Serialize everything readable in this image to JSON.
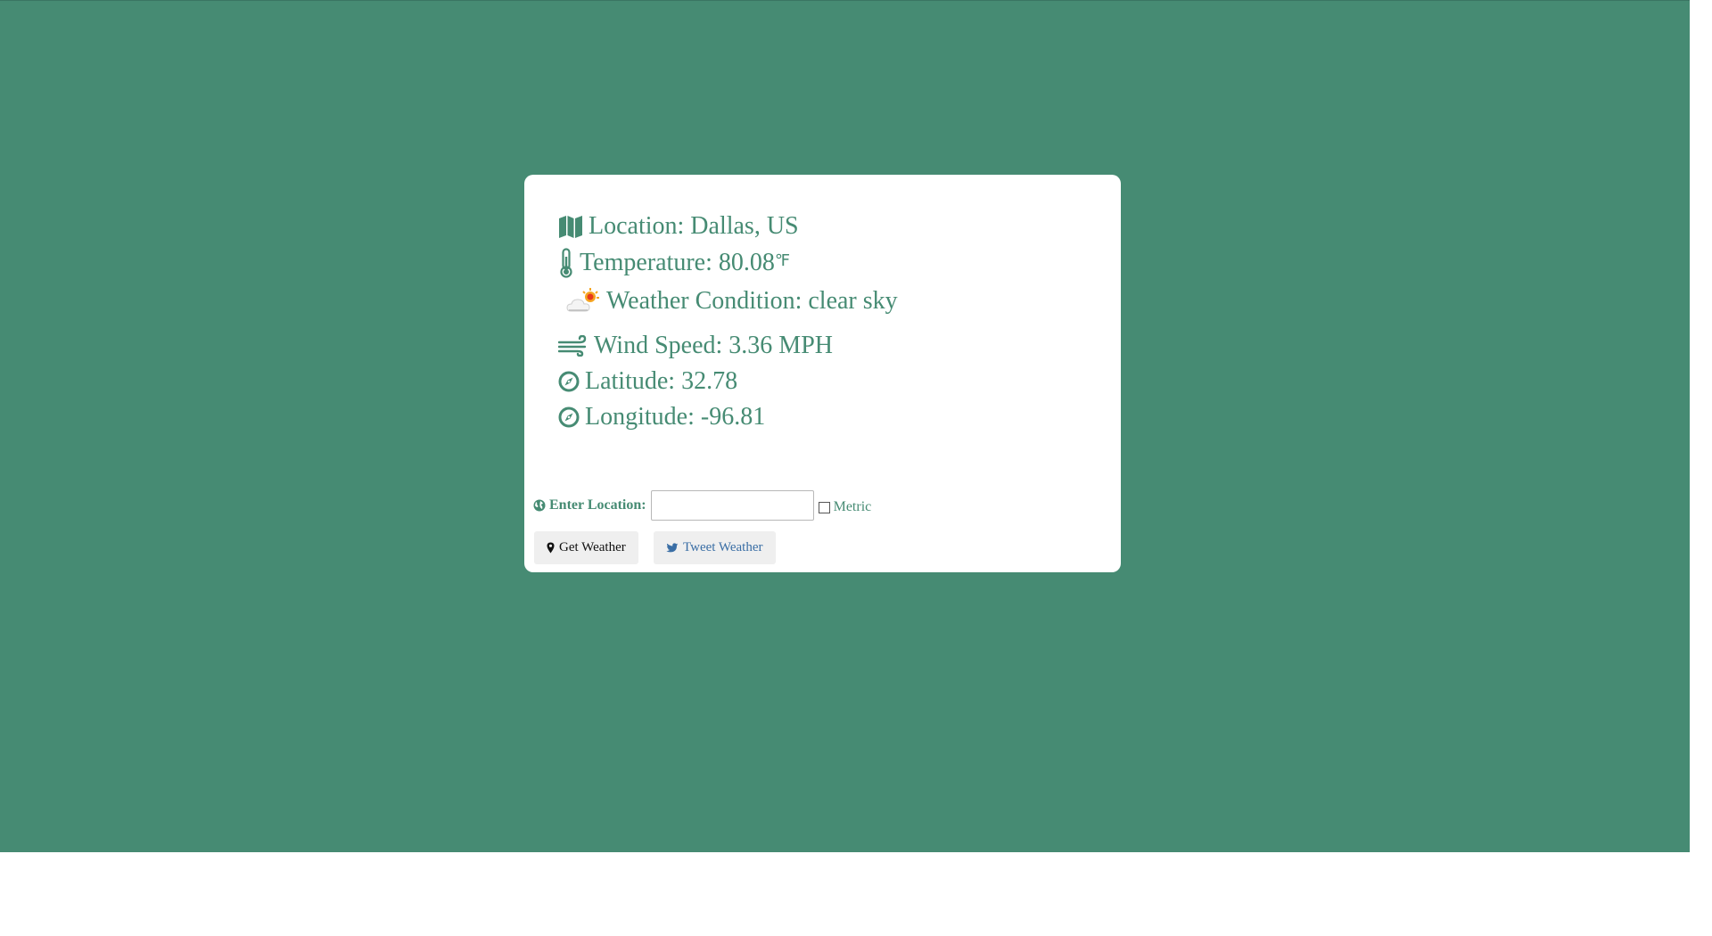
{
  "colors": {
    "background": "#468b73",
    "card": "#ffffff",
    "text": "#468b73",
    "twitter": "#3a6ea5"
  },
  "weather": {
    "location": "Location: Dallas, US",
    "temperature": "Temperature: 80.08",
    "temperature_unit": "℉",
    "condition": "Weather Condition: clear sky",
    "wind": "Wind Speed: 3.36 MPH",
    "latitude": "Latitude: 32.78",
    "longitude": "Longitude: -96.81"
  },
  "icons": {
    "location": "map-icon",
    "temperature": "thermometer-icon",
    "condition": "sun-behind-cloud-icon",
    "wind": "wind-icon",
    "latitude": "compass-icon",
    "longitude": "compass-icon",
    "form": "globe-icon",
    "get_weather": "map-marker-icon",
    "tweet": "twitter-icon"
  },
  "form": {
    "label": "Enter Location:",
    "input_value": "",
    "metric_label": "Metric",
    "metric_checked": false
  },
  "buttons": {
    "get_weather": "Get Weather",
    "tweet_weather": "Tweet Weather"
  }
}
